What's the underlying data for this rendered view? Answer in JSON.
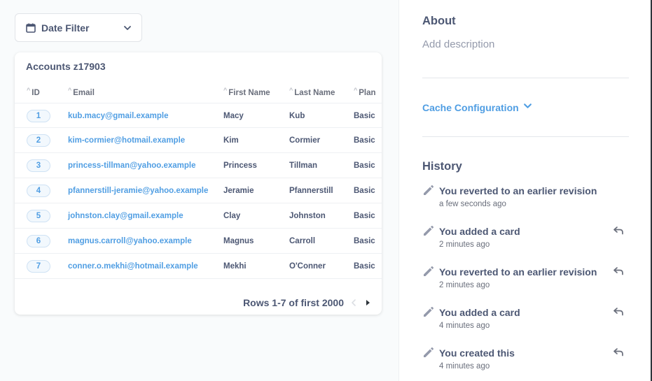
{
  "filter": {
    "label": "Date Filter"
  },
  "table": {
    "title": "Accounts z17903",
    "columns": [
      "ID",
      "Email",
      "First Name",
      "Last Name",
      "Plan"
    ],
    "rows": [
      {
        "id": "1",
        "email": "kub.macy@gmail.example",
        "first": "Macy",
        "last": "Kub",
        "plan": "Basic"
      },
      {
        "id": "2",
        "email": "kim-cormier@hotmail.example",
        "first": "Kim",
        "last": "Cormier",
        "plan": "Basic"
      },
      {
        "id": "3",
        "email": "princess-tillman@yahoo.example",
        "first": "Princess",
        "last": "Tillman",
        "plan": "Basic"
      },
      {
        "id": "4",
        "email": "pfannerstill-jeramie@yahoo.example",
        "first": "Jeramie",
        "last": "Pfannerstill",
        "plan": "Basic"
      },
      {
        "id": "5",
        "email": "johnston.clay@gmail.example",
        "first": "Clay",
        "last": "Johnston",
        "plan": "Basic"
      },
      {
        "id": "6",
        "email": "magnus.carroll@yahoo.example",
        "first": "Magnus",
        "last": "Carroll",
        "plan": "Basic"
      },
      {
        "id": "7",
        "email": "conner.o.mekhi@hotmail.example",
        "first": "Mekhi",
        "last": "O'Conner",
        "plan": "Basic"
      }
    ],
    "pagination": "Rows 1-7 of first 2000"
  },
  "sidebar": {
    "about_title": "About",
    "about_placeholder": "Add description",
    "cache_label": "Cache Configuration",
    "history_title": "History",
    "history": [
      {
        "title": "You reverted to an earlier revision",
        "time": "a few seconds ago",
        "revertable": false
      },
      {
        "title": "You added a card",
        "time": "2 minutes ago",
        "revertable": true
      },
      {
        "title": "You reverted to an earlier revision",
        "time": "2 minutes ago",
        "revertable": true
      },
      {
        "title": "You added a card",
        "time": "4 minutes ago",
        "revertable": true
      },
      {
        "title": "You created this",
        "time": "4 minutes ago",
        "revertable": true
      }
    ]
  },
  "colors": {
    "brand": "#509ee3",
    "text": "#4c5773",
    "muted": "#949aab"
  },
  "icons": {
    "filter": "calendar-icon",
    "dropdown": "chevron-down-icon",
    "history": "pencil-icon",
    "revert": "revert-arrow-icon"
  }
}
